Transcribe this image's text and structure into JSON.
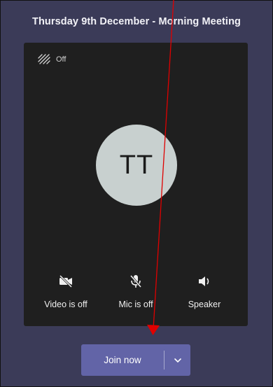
{
  "meeting": {
    "title": "Thursday 9th December - Morning Meeting"
  },
  "preview": {
    "background_effects_label": "Off",
    "background_effects_icon": "background-blur-icon",
    "avatar_initials": "TT",
    "avatar_color": "#c8d0cf"
  },
  "controls": {
    "video": {
      "label": "Video is off",
      "icon": "video-off-icon"
    },
    "mic": {
      "label": "Mic is off",
      "icon": "mic-off-icon"
    },
    "speaker": {
      "label": "Speaker",
      "icon": "speaker-icon"
    }
  },
  "join": {
    "label": "Join now",
    "chevron_icon": "chevron-down-icon",
    "accent_color": "#6264a7"
  },
  "annotation": {
    "arrow_color": "#e00000"
  }
}
